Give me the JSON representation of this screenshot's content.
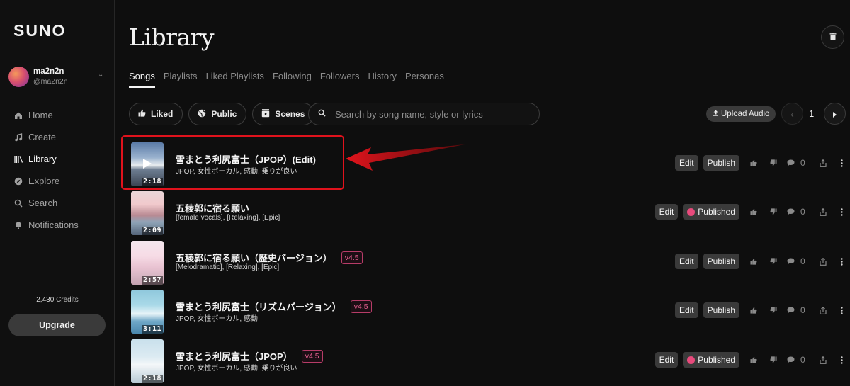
{
  "sidebar": {
    "logo": "SUNO",
    "user": {
      "name": "ma2n2n",
      "handle": "@ma2n2n"
    },
    "nav": [
      "Home",
      "Create",
      "Library",
      "Explore",
      "Search",
      "Notifications"
    ],
    "credits_value": "2,430",
    "credits_label": "Credits",
    "upgrade_label": "Upgrade"
  },
  "header": {
    "title": "Library"
  },
  "tabs": [
    "Songs",
    "Playlists",
    "Liked Playlists",
    "Following",
    "Followers",
    "History",
    "Personas"
  ],
  "filters": [
    "Liked",
    "Public",
    "Scenes"
  ],
  "search": {
    "placeholder": "Search by song name, style or lyrics"
  },
  "toolbar": {
    "upload_label": "Upload Audio",
    "page": "1"
  },
  "songs": [
    {
      "title": "雪まとう利尻富士（JPOP）(Edit)",
      "tags": "JPOP, 女性ボーカル, 感動, 乗りが良い",
      "duration": "2:18",
      "badge": "",
      "edit_label": "Edit",
      "publish_label": "Publish",
      "comments": "0"
    },
    {
      "title": "五稜郭に宿る願い",
      "tags": "[female vocals], [Relaxing], [Epic]",
      "duration": "2:09",
      "badge": "",
      "edit_label": "Edit",
      "publish_label": "Published",
      "comments": "0"
    },
    {
      "title": "五稜郭に宿る願い（歴史バージョン）",
      "tags": "[Melodramatic], [Relaxing], [Epic]",
      "duration": "2:57",
      "badge": "v4.5",
      "edit_label": "Edit",
      "publish_label": "Publish",
      "comments": "0"
    },
    {
      "title": "雪まとう利尻富士（リズムバージョン）",
      "tags": "JPOP, 女性ボーカル, 感動",
      "duration": "3:11",
      "badge": "v4.5",
      "edit_label": "Edit",
      "publish_label": "Publish",
      "comments": "0"
    },
    {
      "title": "雪まとう利尻富士（JPOP）",
      "tags": "JPOP, 女性ボーカル, 感動, 乗りが良い",
      "duration": "2:18",
      "badge": "v4.5",
      "edit_label": "Edit",
      "publish_label": "Published",
      "comments": "0"
    }
  ],
  "colors": {
    "background": "#0e0e0e",
    "button": "#3a3a3a",
    "accent_pink": "#e84a7c",
    "highlight_red": "#e0121c"
  }
}
